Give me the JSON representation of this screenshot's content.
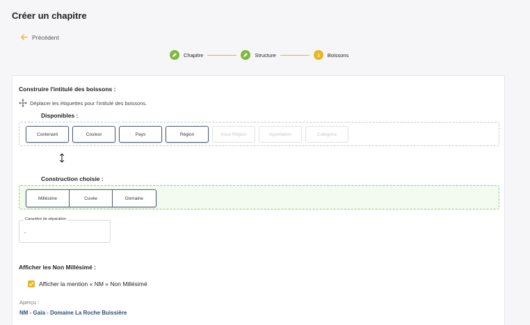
{
  "header": {
    "title": "Créer un chapitre",
    "back_label": "Précédent"
  },
  "stepper": {
    "steps": [
      {
        "label": "Chapitre",
        "status": "done"
      },
      {
        "label": "Structure",
        "status": "done"
      },
      {
        "label": "Boissons",
        "status": "current",
        "number": "3"
      }
    ]
  },
  "builder": {
    "title": "Construire l'intitulé des boissons :",
    "hint": "Déplacer les étiquettes pour l'intitulé des boissons.",
    "available_title": "Disponibles :",
    "available_tags": [
      {
        "label": "Contenant",
        "enabled": true
      },
      {
        "label": "Couleur",
        "enabled": true
      },
      {
        "label": "Pays",
        "enabled": true
      },
      {
        "label": "Région",
        "enabled": true
      },
      {
        "label": "Sous Région",
        "enabled": false
      },
      {
        "label": "Appellation",
        "enabled": false
      },
      {
        "label": "Catégorie",
        "enabled": false
      }
    ],
    "chosen_title": "Construction choisie :",
    "chosen_tags": [
      "Millésime",
      "Cuvée",
      "Domaine"
    ]
  },
  "separator": {
    "label": "Caractère de séparation",
    "value": "-"
  },
  "non_vintage": {
    "title": "Afficher les Non Millésimé :",
    "checkbox_label": "Afficher la mention « NM » Non Millésimé",
    "checked": true
  },
  "preview": {
    "label": "Aperçu :",
    "value": "NM - Gaïa - Domaine La Roche Buissière"
  },
  "colors": {
    "accent": "#e5b627",
    "done": "#7cba3a",
    "preview_text": "#2b4c7e",
    "chosen_zone": "#8fcf6e"
  }
}
